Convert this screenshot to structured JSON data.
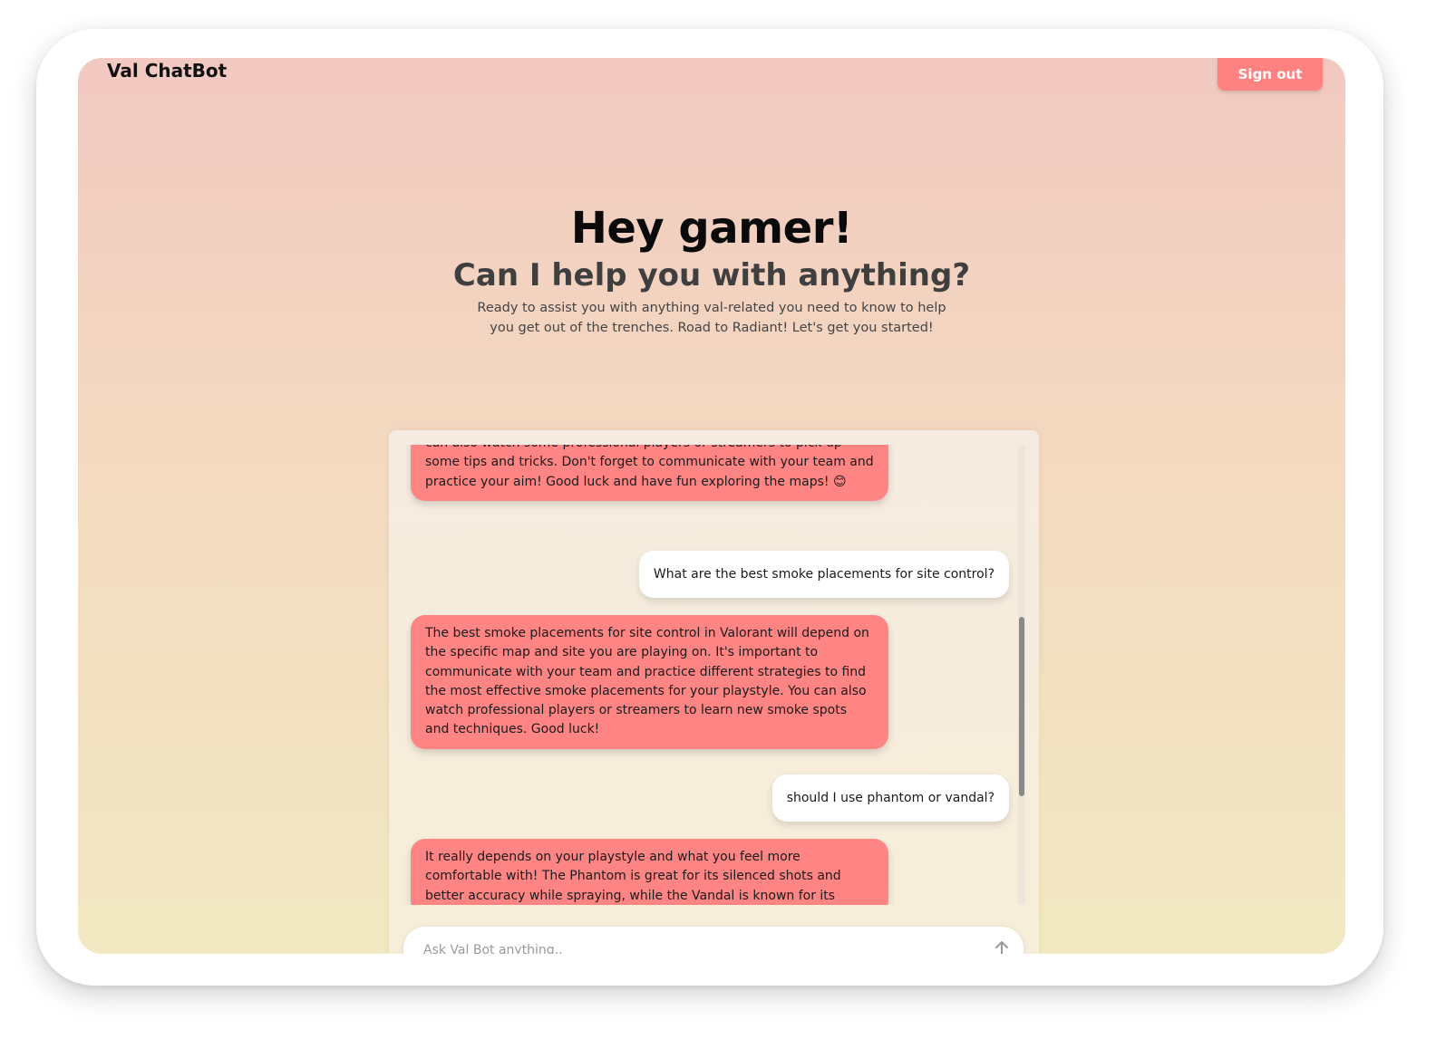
{
  "header": {
    "brand": "Val ChatBot",
    "signout_label": "Sign out"
  },
  "hero": {
    "title": "Hey gamer!",
    "subtitle": "Can I help you with anything?",
    "description": "Ready to assist you with anything val-related you need to know to help you get out of the trenches. Road to Radiant! Let's get you started!"
  },
  "chat": {
    "messages": [
      {
        "role": "bot",
        "text": "can also watch some professional players or streamers to pick up some tips and tricks. Don't forget to communicate with your team and practice your aim! Good luck and have fun exploring the maps! 😊"
      },
      {
        "role": "user",
        "text": "What are the best smoke placements for site control?"
      },
      {
        "role": "bot",
        "text": "The best smoke placements for site control in Valorant will depend on the specific map and site you are playing on. It's important to communicate with your team and practice different strategies to find the most effective smoke placements for your playstyle. You can also watch professional players or streamers to learn new smoke spots and techniques. Good luck!"
      },
      {
        "role": "user",
        "text": "should I use phantom or vandal?"
      },
      {
        "role": "bot",
        "text": "It really depends on your playstyle and what you feel more comfortable with! The Phantom is great for its silenced shots and better accuracy while spraying, while the Vandal is known for its"
      }
    ],
    "input_placeholder": "Ask Val Bot anything.."
  },
  "colors": {
    "accent": "#ff8585",
    "bot_bubble": "#ff8585",
    "user_bubble": "#ffffff"
  },
  "icons": {
    "send": "arrow-up-icon"
  }
}
